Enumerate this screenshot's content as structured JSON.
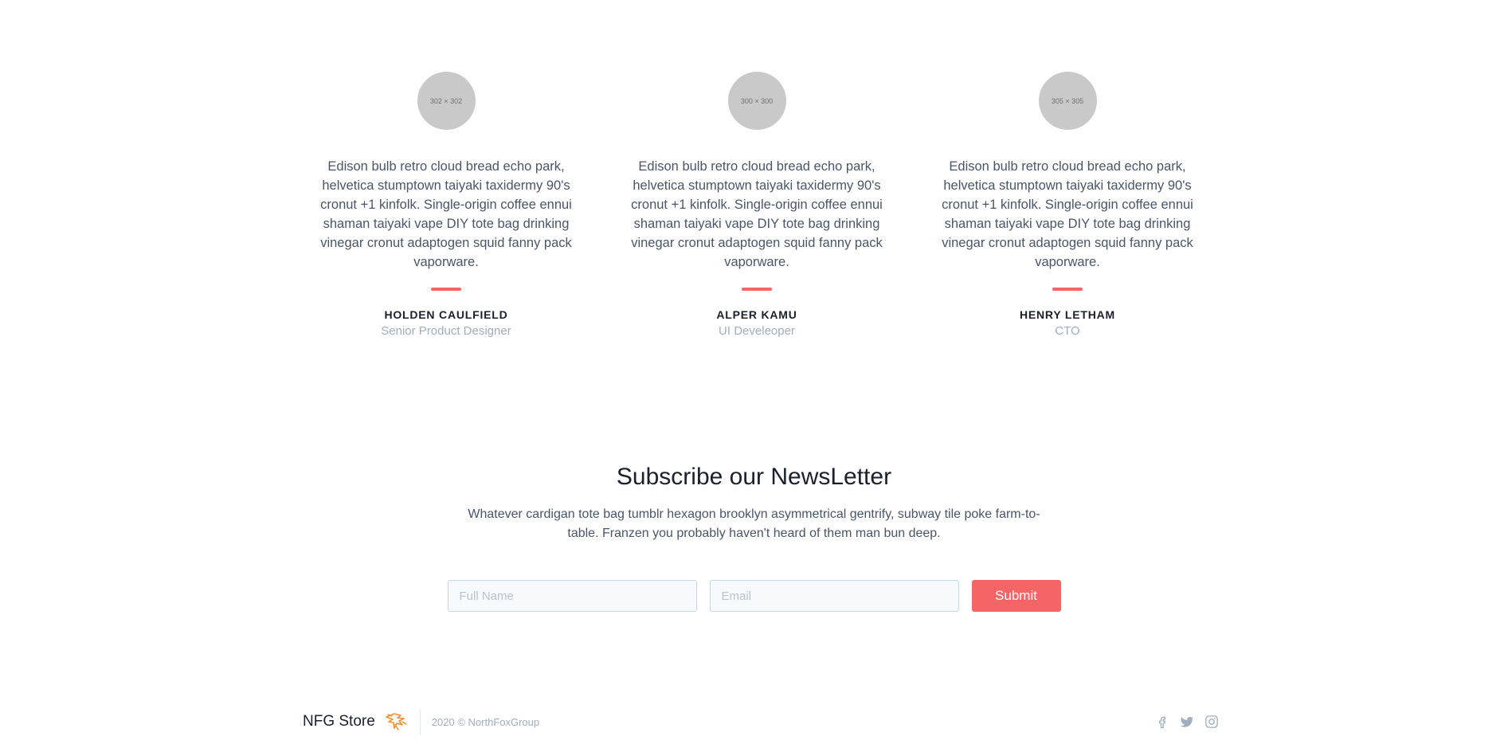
{
  "testimonials": [
    {
      "avatar_label": "302 × 302",
      "quote": "Edison bulb retro cloud bread echo park, helvetica stumptown taiyaki taxidermy 90's cronut +1 kinfolk. Single-origin coffee ennui shaman taiyaki vape DIY tote bag drinking vinegar cronut adaptogen squid fanny pack vaporware.",
      "name": "HOLDEN CAULFIELD",
      "role": "Senior Product Designer"
    },
    {
      "avatar_label": "300 × 300",
      "quote": "Edison bulb retro cloud bread echo park, helvetica stumptown taiyaki taxidermy 90's cronut +1 kinfolk. Single-origin coffee ennui shaman taiyaki vape DIY tote bag drinking vinegar cronut adaptogen squid fanny pack vaporware.",
      "name": "ALPER KAMU",
      "role": "UI Develeoper"
    },
    {
      "avatar_label": "305 × 305",
      "quote": "Edison bulb retro cloud bread echo park, helvetica stumptown taiyaki taxidermy 90's cronut +1 kinfolk. Single-origin coffee ennui shaman taiyaki vape DIY tote bag drinking vinegar cronut adaptogen squid fanny pack vaporware.",
      "name": "HENRY LETHAM",
      "role": "CTO"
    }
  ],
  "newsletter": {
    "title": "Subscribe our NewsLetter",
    "text": "Whatever cardigan tote bag tumblr hexagon brooklyn asymmetrical gentrify, subway tile poke farm-to-table. Franzen you probably haven't heard of them man bun deep.",
    "full_name_placeholder": "Full Name",
    "email_placeholder": "Email",
    "submit_label": "Submit"
  },
  "footer": {
    "brand": "NFG Store",
    "copyright": "2020 © NorthFoxGroup",
    "social_icons": [
      "facebook-icon",
      "twitter-icon",
      "instagram-icon"
    ]
  },
  "colors": {
    "accent": "#f56565",
    "muted": "#a0aec0",
    "heading": "#1a202c"
  }
}
